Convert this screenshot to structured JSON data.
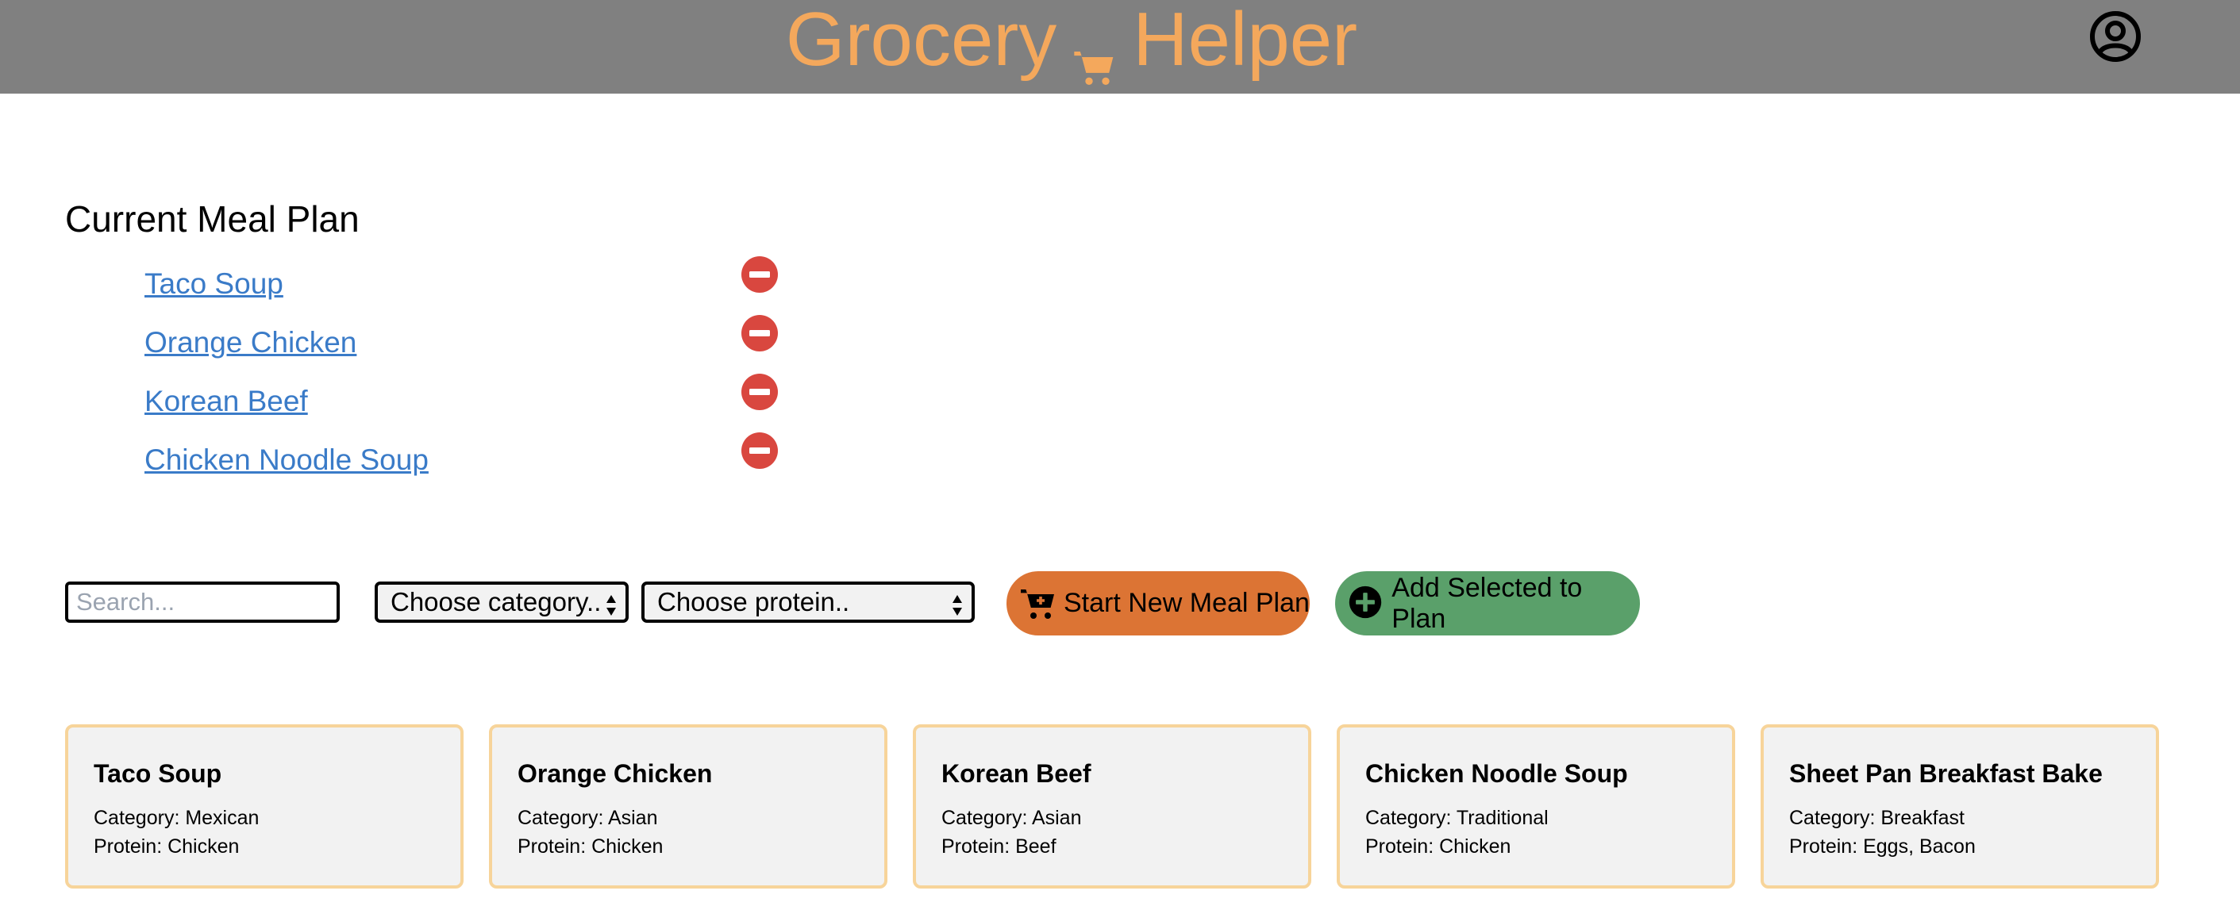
{
  "app": {
    "title_left": "Grocery",
    "title_right": "Helper",
    "brand_color": "#f4a85c",
    "header_bg": "#808080",
    "cart_icon": "shopping-cart-icon",
    "profile_icon": "user-circle-icon"
  },
  "meal_plan": {
    "title": "Current Meal Plan",
    "items": [
      {
        "label": "Taco Soup"
      },
      {
        "label": "Orange Chicken"
      },
      {
        "label": "Korean Beef"
      },
      {
        "label": "Chicken Noodle Soup"
      }
    ],
    "remove_icon": "remove-circle-icon",
    "remove_color": "#d9473f"
  },
  "controls": {
    "search_placeholder": "Search...",
    "search_value": "",
    "category_selected": "Choose category..",
    "protein_selected": "Choose protein..",
    "start_button": "Start New Meal Plan",
    "start_color": "#dc7434",
    "add_button": "Add Selected to Plan",
    "add_color": "#5aa06a"
  },
  "recipes": [
    {
      "name": "Taco Soup",
      "category": "Category: Mexican",
      "protein": "Protein: Chicken"
    },
    {
      "name": "Orange Chicken",
      "category": "Category: Asian",
      "protein": "Protein: Chicken"
    },
    {
      "name": "Korean Beef",
      "category": "Category: Asian",
      "protein": "Protein: Beef"
    },
    {
      "name": "Chicken Noodle Soup",
      "category": "Category: Traditional",
      "protein": "Protein: Chicken"
    },
    {
      "name": "Sheet Pan Breakfast Bake",
      "category": "Category: Breakfast",
      "protein": "Protein: Eggs, Bacon"
    }
  ]
}
